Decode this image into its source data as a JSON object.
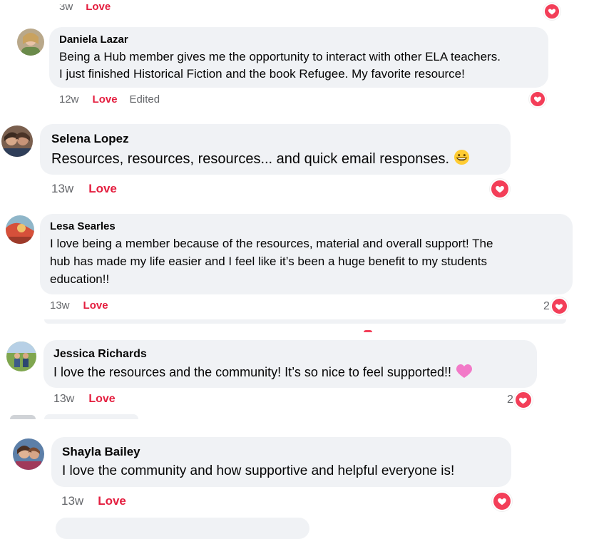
{
  "top_partial": {
    "time": "3w",
    "love": "Love"
  },
  "comments": [
    {
      "author": "Daniela Lazar",
      "lines": [
        "Being a Hub member gives me the opportunity to interact with other ELA teachers.",
        "I just finished Historical Fiction and the book Refugee. My favorite resource!"
      ],
      "time": "12w",
      "love": "Love",
      "edited": "Edited",
      "reaction_count": ""
    },
    {
      "author": "Selena Lopez",
      "lines": [
        "Resources, resources, resources... and quick email responses."
      ],
      "emoji": "grinning-face-emoji",
      "time": "13w",
      "love": "Love",
      "reaction_count": ""
    },
    {
      "author": "Lesa Searles",
      "lines": [
        "I love being a member because of the resources, material and overall support! The",
        "hub has made my life easier and I feel like it’s been a huge benefit to my students",
        "education!!"
      ],
      "time": "13w",
      "love": "Love",
      "reaction_count": "2"
    },
    {
      "author": "Jessica Richards",
      "lines": [
        "I love the resources and the community! It’s so nice to feel supported!!"
      ],
      "emoji": "pink-heart-emoji",
      "time": "13w",
      "love": "Love",
      "reaction_count": "2"
    },
    {
      "author": "Shayla Bailey",
      "lines": [
        "I love the community and how supportive and helpful everyone is!"
      ],
      "time": "13w",
      "love": "Love",
      "reaction_count": ""
    }
  ],
  "colors": {
    "bubble": "#f0f2f5",
    "love": "#e41e3f",
    "heart": "#f33e58",
    "meta": "#65676b"
  }
}
